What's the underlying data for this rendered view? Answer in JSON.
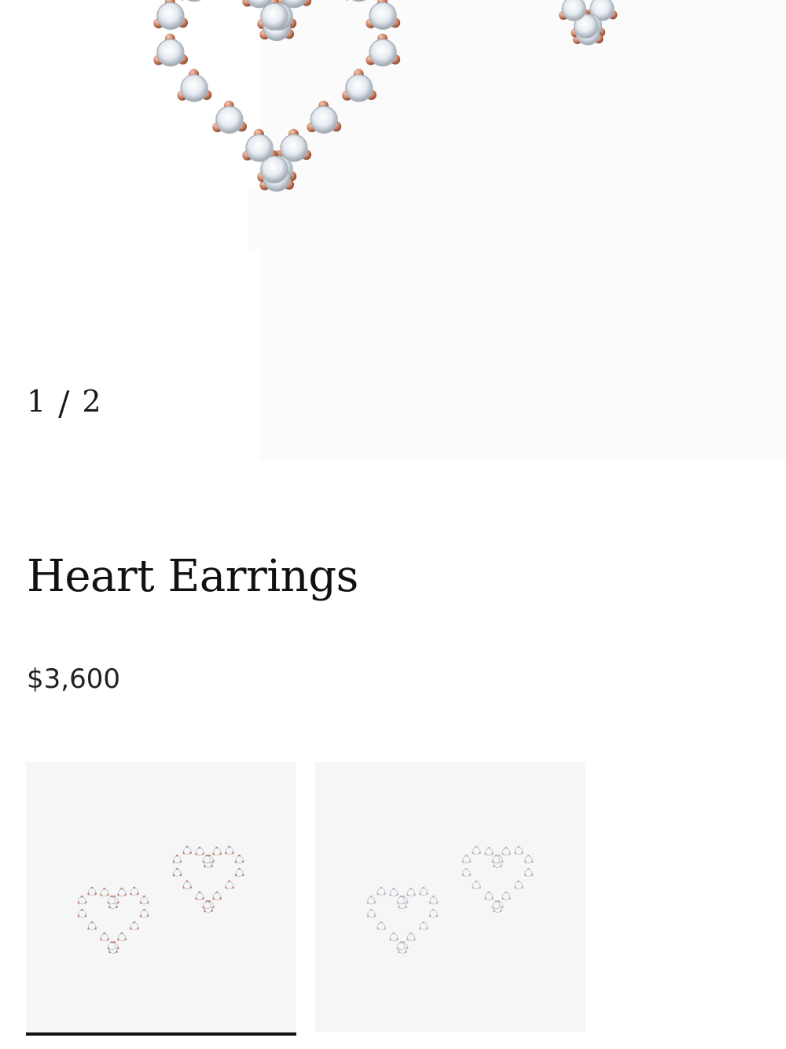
{
  "gallery": {
    "current": "1",
    "separator": "/",
    "total": "2",
    "image_icon": "heart-diamond-earring-icon"
  },
  "product": {
    "title": "Heart Earrings",
    "price": "$3,600"
  },
  "variants": [
    {
      "metal_color": "#c9826a",
      "icon": "rose-gold-heart-earrings-icon",
      "selected": true
    },
    {
      "metal_color": "#b9bcc0",
      "icon": "platinum-heart-earrings-icon",
      "selected": false
    }
  ]
}
